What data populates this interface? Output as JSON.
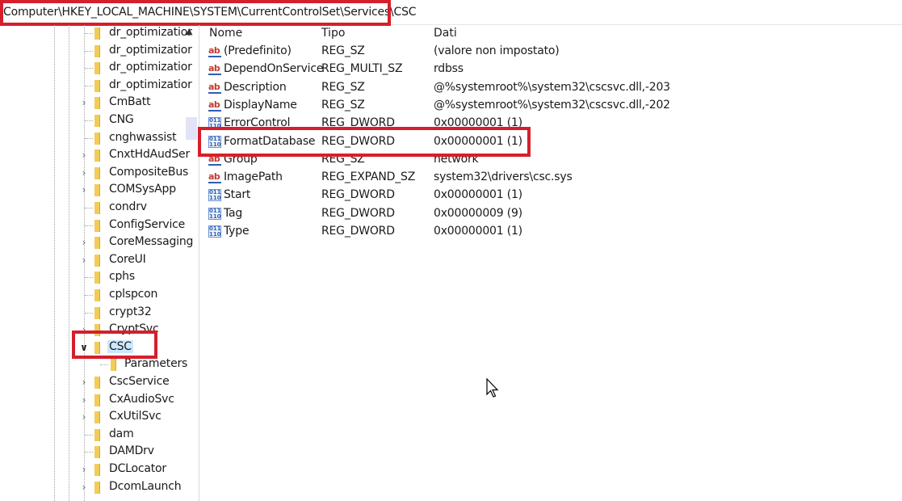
{
  "address_bar": {
    "path": "Computer\\HKEY_LOCAL_MACHINE\\SYSTEM\\CurrentControlSet\\Services\\CSC"
  },
  "tree": {
    "items": [
      {
        "label": "dr_optimizatior",
        "expandable": false,
        "indent": 0
      },
      {
        "label": "dr_optimizatior",
        "expandable": false,
        "indent": 0
      },
      {
        "label": "dr_optimizatior",
        "expandable": false,
        "indent": 0
      },
      {
        "label": "dr_optimizatior",
        "expandable": false,
        "indent": 0
      },
      {
        "label": "CmBatt",
        "expandable": true,
        "indent": 0
      },
      {
        "label": "CNG",
        "expandable": false,
        "indent": 0
      },
      {
        "label": "cnghwassist",
        "expandable": false,
        "indent": 0
      },
      {
        "label": "CnxtHdAudSer",
        "expandable": true,
        "indent": 0
      },
      {
        "label": "CompositeBus",
        "expandable": true,
        "indent": 0
      },
      {
        "label": "COMSysApp",
        "expandable": true,
        "indent": 0
      },
      {
        "label": "condrv",
        "expandable": false,
        "indent": 0
      },
      {
        "label": "ConfigService",
        "expandable": false,
        "indent": 0
      },
      {
        "label": "CoreMessaging",
        "expandable": true,
        "indent": 0
      },
      {
        "label": "CoreUI",
        "expandable": true,
        "indent": 0
      },
      {
        "label": "cphs",
        "expandable": false,
        "indent": 0
      },
      {
        "label": "cplspcon",
        "expandable": false,
        "indent": 0
      },
      {
        "label": "crypt32",
        "expandable": false,
        "indent": 0
      },
      {
        "label": "CryptSvc",
        "expandable": true,
        "indent": 0
      },
      {
        "label": "CSC",
        "expandable": true,
        "expanded": true,
        "selected": true,
        "indent": 0
      },
      {
        "label": "Parameters",
        "expandable": false,
        "indent": 1
      },
      {
        "label": "CscService",
        "expandable": true,
        "indent": 0
      },
      {
        "label": "CxAudioSvc",
        "expandable": true,
        "indent": 0
      },
      {
        "label": "CxUtilSvc",
        "expandable": true,
        "indent": 0
      },
      {
        "label": "dam",
        "expandable": false,
        "indent": 0
      },
      {
        "label": "DAMDrv",
        "expandable": false,
        "indent": 0
      },
      {
        "label": "DCLocator",
        "expandable": true,
        "indent": 0
      },
      {
        "label": "DcomLaunch",
        "expandable": true,
        "indent": 0
      }
    ]
  },
  "values": {
    "columns": {
      "name": "Nome",
      "type": "Tipo",
      "data": "Dati"
    },
    "rows": [
      {
        "name": "(Predefinito)",
        "type": "REG_SZ",
        "data": "(valore non impostato)",
        "icon": "string-value-icon"
      },
      {
        "name": "DependOnService",
        "type": "REG_MULTI_SZ",
        "data": "rdbss",
        "icon": "string-value-icon"
      },
      {
        "name": "Description",
        "type": "REG_SZ",
        "data": "@%systemroot%\\system32\\cscsvc.dll,-203",
        "icon": "string-value-icon"
      },
      {
        "name": "DisplayName",
        "type": "REG_SZ",
        "data": "@%systemroot%\\system32\\cscsvc.dll,-202",
        "icon": "string-value-icon"
      },
      {
        "name": "ErrorControl",
        "type": "REG_DWORD",
        "data": "0x00000001 (1)",
        "icon": "binary-value-icon"
      },
      {
        "name": "FormatDatabase",
        "type": "REG_DWORD",
        "data": "0x00000001 (1)",
        "icon": "binary-value-icon"
      },
      {
        "name": "Group",
        "type": "REG_SZ",
        "data": "network",
        "icon": "string-value-icon"
      },
      {
        "name": "ImagePath",
        "type": "REG_EXPAND_SZ",
        "data": "system32\\drivers\\csc.sys",
        "icon": "string-value-icon"
      },
      {
        "name": "Start",
        "type": "REG_DWORD",
        "data": "0x00000001 (1)",
        "icon": "binary-value-icon"
      },
      {
        "name": "Tag",
        "type": "REG_DWORD",
        "data": "0x00000009 (9)",
        "icon": "binary-value-icon"
      },
      {
        "name": "Type",
        "type": "REG_DWORD",
        "data": "0x00000001 (1)",
        "icon": "binary-value-icon"
      }
    ]
  },
  "colors": {
    "highlight": "#d51f2b",
    "selection": "#cce8ff",
    "folder": "#f2cc57"
  }
}
